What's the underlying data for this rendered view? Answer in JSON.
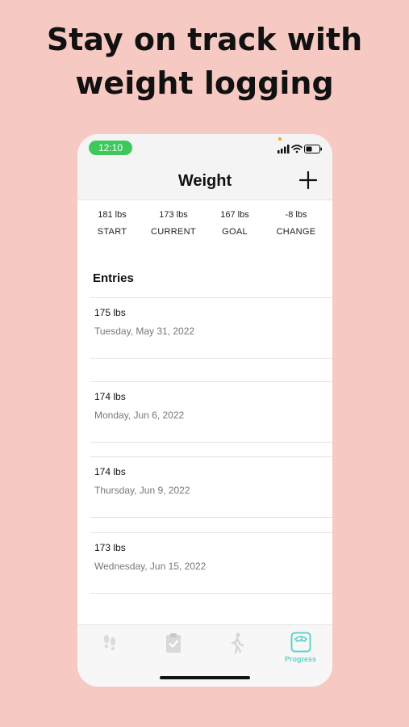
{
  "promo": {
    "headline_line1": "Stay on track with",
    "headline_line2": "weight logging"
  },
  "status_bar": {
    "time": "12:10",
    "icons": [
      "signal-icon",
      "wifi-icon",
      "battery-icon"
    ]
  },
  "nav": {
    "title": "Weight",
    "add_icon": "plus-icon"
  },
  "stats": [
    {
      "value": "181 lbs",
      "label": "START"
    },
    {
      "value": "173 lbs",
      "label": "CURRENT"
    },
    {
      "value": "167 lbs",
      "label": "GOAL"
    },
    {
      "value": "-8 lbs",
      "label": "CHANGE"
    }
  ],
  "entries_heading": "Entries",
  "entries": [
    {
      "weight": "175 lbs",
      "date": "Tuesday, May 31, 2022"
    },
    {
      "weight": "174 lbs",
      "date": "Monday, Jun 6, 2022"
    },
    {
      "weight": "174 lbs",
      "date": "Thursday, Jun 9, 2022"
    },
    {
      "weight": "173 lbs",
      "date": "Wednesday,  Jun 15, 2022"
    }
  ],
  "tabs": [
    {
      "icon": "footprints-icon",
      "label": "",
      "active": false
    },
    {
      "icon": "clipboard-check-icon",
      "label": "",
      "active": false
    },
    {
      "icon": "walking-person-icon",
      "label": "",
      "active": false
    },
    {
      "icon": "scale-icon",
      "label": "Progress",
      "active": true
    }
  ],
  "colors": {
    "background": "#f7c9c3",
    "time_pill": "#3cc85a",
    "active_tab": "#5fd4c8",
    "inactive_tab": "#d9d9dc"
  }
}
